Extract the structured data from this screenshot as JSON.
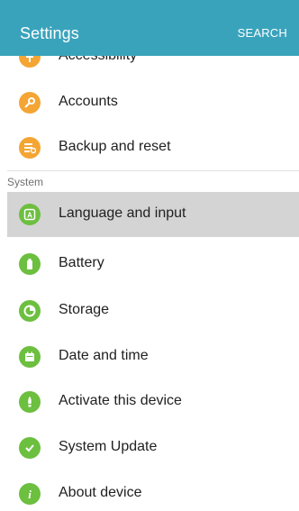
{
  "header": {
    "title": "Settings",
    "search_label": "SEARCH"
  },
  "colors": {
    "appbar": "#3aa3bc",
    "orange": "#f4a533",
    "green": "#6cbf3f",
    "selected_row": "#d4d4d4"
  },
  "section": {
    "label": "System"
  },
  "items": [
    {
      "label": "Accessibility",
      "icon": "accessibility-icon",
      "color": "#f4a533",
      "selected": false
    },
    {
      "label": "Accounts",
      "icon": "key-icon",
      "color": "#f4a533",
      "selected": false
    },
    {
      "label": "Backup and reset",
      "icon": "backup-reset-icon",
      "color": "#f4a533",
      "selected": false
    },
    {
      "label": "Language and input",
      "icon": "language-icon",
      "color": "#6cbf3f",
      "selected": true
    },
    {
      "label": "Battery",
      "icon": "battery-icon",
      "color": "#6cbf3f",
      "selected": false
    },
    {
      "label": "Storage",
      "icon": "storage-icon",
      "color": "#6cbf3f",
      "selected": false
    },
    {
      "label": "Date and time",
      "icon": "calendar-icon",
      "color": "#6cbf3f",
      "selected": false
    },
    {
      "label": "Activate this device",
      "icon": "activate-device-icon",
      "color": "#6cbf3f",
      "selected": false
    },
    {
      "label": "System Update",
      "icon": "system-update-icon",
      "color": "#6cbf3f",
      "selected": false
    },
    {
      "label": "About device",
      "icon": "info-icon",
      "color": "#6cbf3f",
      "selected": false
    }
  ]
}
